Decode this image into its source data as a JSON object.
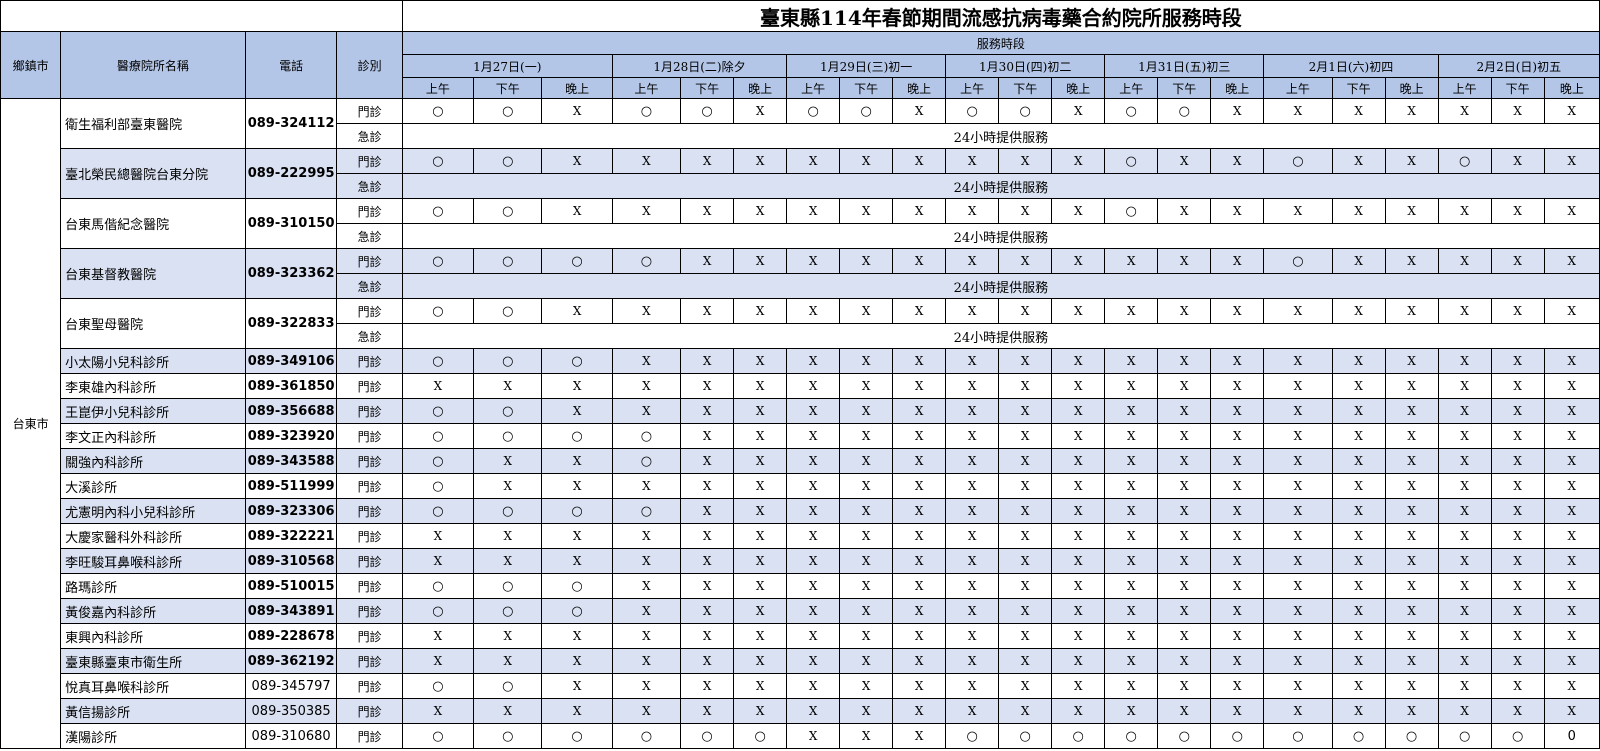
{
  "title": "臺東縣114年春節期間流感抗病毒藥合約院所服務時段",
  "headers": {
    "town": "鄉鎮市",
    "name": "醫療院所名稱",
    "phone": "電話",
    "type": "診別",
    "service": "服務時段"
  },
  "days": [
    "1月27日(一)",
    "1月28日(二)除夕",
    "1月29日(三)初一",
    "1月30日(四)初二",
    "1月31日(五)初三",
    "2月1日(六)初四",
    "2月2日(日)初五"
  ],
  "periods": [
    "上午",
    "下午",
    "晚上"
  ],
  "town_name": "台東市",
  "type_labels": {
    "outpatient": "門診",
    "emergency": "急診"
  },
  "er_text": "24小時提供服務",
  "symbols": {
    "open": "○",
    "closed": "X",
    "zero": "0"
  },
  "hospitals": [
    {
      "name": "衛生福利部臺東醫院",
      "phone": "089-324112",
      "shade": false,
      "slots": [
        "○",
        "○",
        "X",
        "○",
        "○",
        "X",
        "○",
        "○",
        "X",
        "○",
        "○",
        "X",
        "○",
        "○",
        "X",
        "X",
        "X",
        "X",
        "X",
        "X",
        "X"
      ]
    },
    {
      "name": "臺北榮民總醫院台東分院",
      "phone": "089-222995",
      "shade": true,
      "slots": [
        "○",
        "○",
        "X",
        "X",
        "X",
        "X",
        "X",
        "X",
        "X",
        "X",
        "X",
        "X",
        "○",
        "X",
        "X",
        "○",
        "X",
        "X",
        "○",
        "X",
        "X"
      ]
    },
    {
      "name": "台東馬偕紀念醫院",
      "phone": "089-310150",
      "shade": false,
      "slots": [
        "○",
        "○",
        "X",
        "X",
        "X",
        "X",
        "X",
        "X",
        "X",
        "X",
        "X",
        "X",
        "○",
        "X",
        "X",
        "X",
        "X",
        "X",
        "X",
        "X",
        "X"
      ]
    },
    {
      "name": "台東基督教醫院",
      "phone": "089-323362",
      "shade": true,
      "slots": [
        "○",
        "○",
        "○",
        "○",
        "X",
        "X",
        "X",
        "X",
        "X",
        "X",
        "X",
        "X",
        "X",
        "X",
        "X",
        "○",
        "X",
        "X",
        "X",
        "X",
        "X"
      ]
    },
    {
      "name": "台東聖母醫院",
      "phone": "089-322833",
      "shade": false,
      "slots": [
        "○",
        "○",
        "X",
        "X",
        "X",
        "X",
        "X",
        "X",
        "X",
        "X",
        "X",
        "X",
        "X",
        "X",
        "X",
        "X",
        "X",
        "X",
        "X",
        "X",
        "X"
      ]
    }
  ],
  "clinics": [
    {
      "name": "小太陽小兒科診所",
      "phone": "089-349106",
      "shade": true,
      "bold": true,
      "slots": [
        "○",
        "○",
        "○",
        "X",
        "X",
        "X",
        "X",
        "X",
        "X",
        "X",
        "X",
        "X",
        "X",
        "X",
        "X",
        "X",
        "X",
        "X",
        "X",
        "X",
        "X"
      ]
    },
    {
      "name": "李東雄內科診所",
      "phone": "089-361850",
      "shade": false,
      "bold": true,
      "slots": [
        "X",
        "X",
        "X",
        "X",
        "X",
        "X",
        "X",
        "X",
        "X",
        "X",
        "X",
        "X",
        "X",
        "X",
        "X",
        "X",
        "X",
        "X",
        "X",
        "X",
        "X"
      ]
    },
    {
      "name": "王崑伊小兒科診所",
      "phone": "089-356688",
      "shade": true,
      "bold": true,
      "slots": [
        "○",
        "○",
        "X",
        "X",
        "X",
        "X",
        "X",
        "X",
        "X",
        "X",
        "X",
        "X",
        "X",
        "X",
        "X",
        "X",
        "X",
        "X",
        "X",
        "X",
        "X"
      ]
    },
    {
      "name": "李文正內科診所",
      "phone": "089-323920",
      "shade": false,
      "bold": true,
      "slots": [
        "○",
        "○",
        "○",
        "○",
        "X",
        "X",
        "X",
        "X",
        "X",
        "X",
        "X",
        "X",
        "X",
        "X",
        "X",
        "X",
        "X",
        "X",
        "X",
        "X",
        "X"
      ]
    },
    {
      "name": "關強內科診所",
      "phone": "089-343588",
      "shade": true,
      "bold": true,
      "slots": [
        "○",
        "X",
        "X",
        "○",
        "X",
        "X",
        "X",
        "X",
        "X",
        "X",
        "X",
        "X",
        "X",
        "X",
        "X",
        "X",
        "X",
        "X",
        "X",
        "X",
        "X"
      ]
    },
    {
      "name": "大溪診所",
      "phone": "089-511999",
      "shade": false,
      "bold": true,
      "slots": [
        "○",
        "X",
        "X",
        "X",
        "X",
        "X",
        "X",
        "X",
        "X",
        "X",
        "X",
        "X",
        "X",
        "X",
        "X",
        "X",
        "X",
        "X",
        "X",
        "X",
        "X"
      ]
    },
    {
      "name": "尤憲明內科小兒科診所",
      "phone": "089-323306",
      "shade": true,
      "bold": true,
      "slots": [
        "○",
        "○",
        "○",
        "○",
        "X",
        "X",
        "X",
        "X",
        "X",
        "X",
        "X",
        "X",
        "X",
        "X",
        "X",
        "X",
        "X",
        "X",
        "X",
        "X",
        "X"
      ]
    },
    {
      "name": "大慶家醫科外科診所",
      "phone": "089-322221",
      "shade": false,
      "bold": true,
      "slots": [
        "X",
        "X",
        "X",
        "X",
        "X",
        "X",
        "X",
        "X",
        "X",
        "X",
        "X",
        "X",
        "X",
        "X",
        "X",
        "X",
        "X",
        "X",
        "X",
        "X",
        "X"
      ]
    },
    {
      "name": "李旺駿耳鼻喉科診所",
      "phone": "089-310568",
      "shade": true,
      "bold": true,
      "slots": [
        "X",
        "X",
        "X",
        "X",
        "X",
        "X",
        "X",
        "X",
        "X",
        "X",
        "X",
        "X",
        "X",
        "X",
        "X",
        "X",
        "X",
        "X",
        "X",
        "X",
        "X"
      ]
    },
    {
      "name": "路瑪診所",
      "phone": "089-510015",
      "shade": false,
      "bold": true,
      "slots": [
        "○",
        "○",
        "○",
        "X",
        "X",
        "X",
        "X",
        "X",
        "X",
        "X",
        "X",
        "X",
        "X",
        "X",
        "X",
        "X",
        "X",
        "X",
        "X",
        "X",
        "X"
      ]
    },
    {
      "name": "黃俊嘉內科診所",
      "phone": "089-343891",
      "shade": true,
      "bold": true,
      "slots": [
        "○",
        "○",
        "○",
        "X",
        "X",
        "X",
        "X",
        "X",
        "X",
        "X",
        "X",
        "X",
        "X",
        "X",
        "X",
        "X",
        "X",
        "X",
        "X",
        "X",
        "X"
      ]
    },
    {
      "name": "東興內科診所",
      "phone": "089-228678",
      "shade": false,
      "bold": true,
      "slots": [
        "X",
        "X",
        "X",
        "X",
        "X",
        "X",
        "X",
        "X",
        "X",
        "X",
        "X",
        "X",
        "X",
        "X",
        "X",
        "X",
        "X",
        "X",
        "X",
        "X",
        "X"
      ]
    },
    {
      "name": "臺東縣臺東市衛生所",
      "phone": "089-362192",
      "shade": true,
      "bold": true,
      "slots": [
        "X",
        "X",
        "X",
        "X",
        "X",
        "X",
        "X",
        "X",
        "X",
        "X",
        "X",
        "X",
        "X",
        "X",
        "X",
        "X",
        "X",
        "X",
        "X",
        "X",
        "X"
      ]
    },
    {
      "name": "悅真耳鼻喉科診所",
      "phone": "089-345797",
      "shade": false,
      "bold": false,
      "slots": [
        "○",
        "○",
        "X",
        "X",
        "X",
        "X",
        "X",
        "X",
        "X",
        "X",
        "X",
        "X",
        "X",
        "X",
        "X",
        "X",
        "X",
        "X",
        "X",
        "X",
        "X"
      ]
    },
    {
      "name": "黃信揚診所",
      "phone": "089-350385",
      "shade": true,
      "bold": false,
      "slots": [
        "X",
        "X",
        "X",
        "X",
        "X",
        "X",
        "X",
        "X",
        "X",
        "X",
        "X",
        "X",
        "X",
        "X",
        "X",
        "X",
        "X",
        "X",
        "X",
        "X",
        "X"
      ]
    },
    {
      "name": "漢陽診所",
      "phone": "089-310680",
      "shade": false,
      "bold": false,
      "slots": [
        "○",
        "○",
        "○",
        "○",
        "○",
        "○",
        "X",
        "X",
        "X",
        "○",
        "○",
        "○",
        "○",
        "○",
        "○",
        "○",
        "○",
        "○",
        "○",
        "○",
        "0"
      ]
    }
  ]
}
